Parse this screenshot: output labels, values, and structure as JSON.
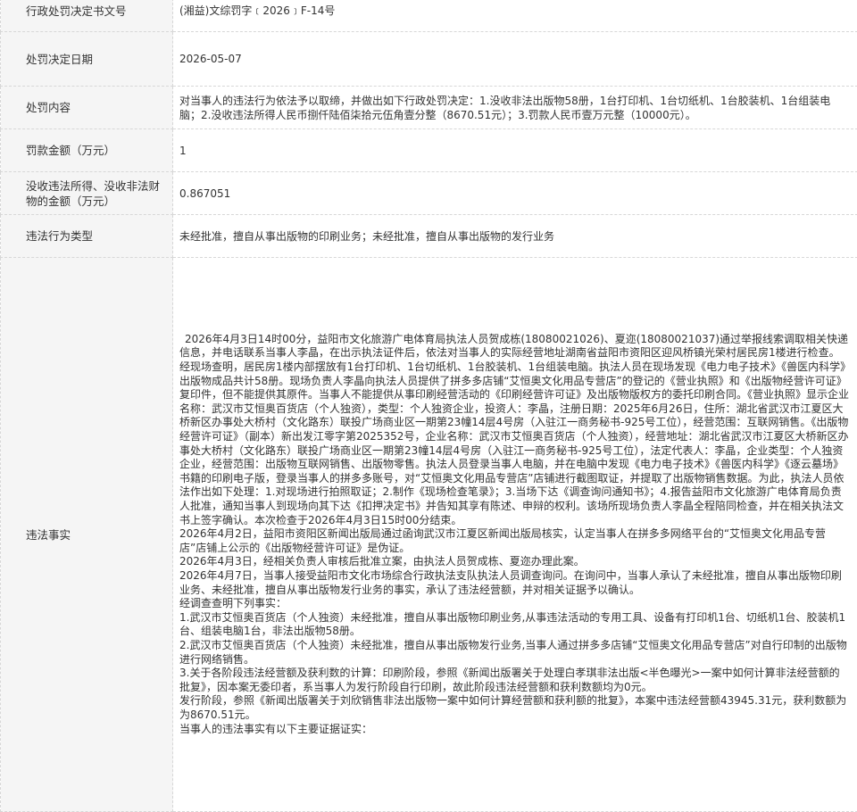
{
  "rows": {
    "doc_no": {
      "label": "行政处罚决定书文号",
      "value": "(湘益)文综罚字﹝2026﹞F-14号"
    },
    "decision_date": {
      "label": "处罚决定日期",
      "value": "2026-05-07"
    },
    "content": {
      "label": "处罚内容",
      "value": "对当事人的违法行为依法予以取缔，并做出如下行政处罚决定：1.没收非法出版物58册，1台打印机、1台切纸机、1台胶装机、1台组装电脑；2.没收违法所得人民币捌仟陆佰柒拾元伍角壹分整（8670.51元）；3.罚款人民币壹万元整（10000元）。"
    },
    "fine": {
      "label": "罚款金额（万元）",
      "value": "1"
    },
    "confiscation": {
      "label": "没收违法所得、没收非法财物的金额（万元）",
      "value": "0.867051"
    },
    "violation_type": {
      "label": "违法行为类型",
      "value": "未经批准，擅自从事出版物的印刷业务；未经批准，擅自从事出版物的发行业务"
    },
    "facts": {
      "label": "违法事实",
      "paragraphs": [
        "2026年4月3日14时00分，益阳市文化旅游广电体育局执法人员贺成栋(18080021026)、夏迩(18080021037)通过举报线索调取相关快递信息，并电话联系当事人李晶，在出示执法证件后，依法对当事人的实际经营地址湖南省益阳市资阳区迎风桥镇光荣村居民房1楼进行检查。经现场查明，居民房1楼内部摆放有1台打印机、1台切纸机、1台胶装机、1台组装电脑。执法人员在现场发现《电力电子技术》《兽医内科学》出版物成品共计58册。现场负责人李晶向执法人员提供了拼多多店铺“艾恒奥文化用品专营店”的登记的《营业执照》和《出版物经营许可证》复印件，但不能提供其原件。当事人不能提供从事印刷经营活动的《印刷经营许可证》及出版物版权方的委托印刷合同。《营业执照》显示企业名称：武汉市艾恒奥百货店（个人独资），类型：个人独资企业，投资人：李晶，注册日期：2025年6月26日，住所：湖北省武汉市江夏区大桥新区办事处大桥村（文化路东）联投广场商业区一期第23幢14层4号房（入驻江一商务秘书-925号工位），经营范围：互联网销售。《出版物经营许可证》（副本）新出发江零字第2025352号，企业名称：武汉市艾恒奥百货店（个人独资），经营地址：湖北省武汉市江夏区大桥新区办事处大桥村（文化路东）联投广场商业区一期第23幢14层4号房（入驻江一商务秘书-925号工位），法定代表人：李晶，企业类型：个人独资企业，经营范围：出版物互联网销售、出版物零售。执法人员登录当事人电脑，并在电脑中发现《电力电子技术》《兽医内科学》《逐云墓场》书籍的印刷电子版，登录当事人的拼多多账号，对“艾恒奥文化用品专营店”店铺进行截图取证，并提取了出版物销售数据。为此，执法人员依法作出如下处理：1.对现场进行拍照取证；2.制作《现场检查笔录》；3.当场下达《调查询问通知书》；4.报告益阳市文化旅游广电体育局负责人批准，通知当事人到现场向其下达《扣押决定书》并告知其享有陈述、申辩的权利。该场所现场负责人李晶全程陪同检查，并在相关执法文书上签字确认。本次检查于2026年4月3日15时00分结束。",
        "2026年4月2日，益阳市资阳区新闻出版局通过函询武汉市江夏区新闻出版局核实，认定当事人在拼多多网络平台的“艾恒奥文化用品专营店”店铺上公示的《出版物经营许可证》是伪证。",
        "2026年4月3日，经相关负责人审核后批准立案，由执法人员贺成栋、夏迩办理此案。",
        "2026年4月7日，当事人接受益阳市文化市场综合行政执法支队执法人员调查询问。在询问中，当事人承认了未经批准，擅自从事出版物印刷业务、未经批准，擅自从事出版物发行业务的事实，承认了违法经营额，并对相关证据予以确认。",
        "经调查查明下列事实：",
        "1.武汉市艾恒奥百货店（个人独资）未经批准，擅自从事出版物印刷业务,从事违法活动的专用工具、设备有打印机1台、切纸机1台、胶装机1台、组装电脑1台，非法出版物58册。",
        "2.武汉市艾恒奥百货店（个人独资）未经批准，擅自从事出版物发行业务,当事人通过拼多多店铺“艾恒奥文化用品专营店”对自行印制的出版物进行网络销售。",
        "3.关于各阶段违法经营额及获利数的计算：印刷阶段，参照《新闻出版署关于处理白孝琪非法出版<半色曝光>一案中如何计算非法经营额的批复》，因本案无委印者，系当事人为发行阶段自行印刷，故此阶段违法经营额和获利数额均为0元。",
        "发行阶段，参照《新闻出版署关于刘欣销售非法出版物一案中如何计算经营额和获利额的批复》，本案中违法经营额43945.31元，获利数额为为8670.51元。",
        "当事人的违法事实有以下主要证据证实："
      ]
    }
  }
}
